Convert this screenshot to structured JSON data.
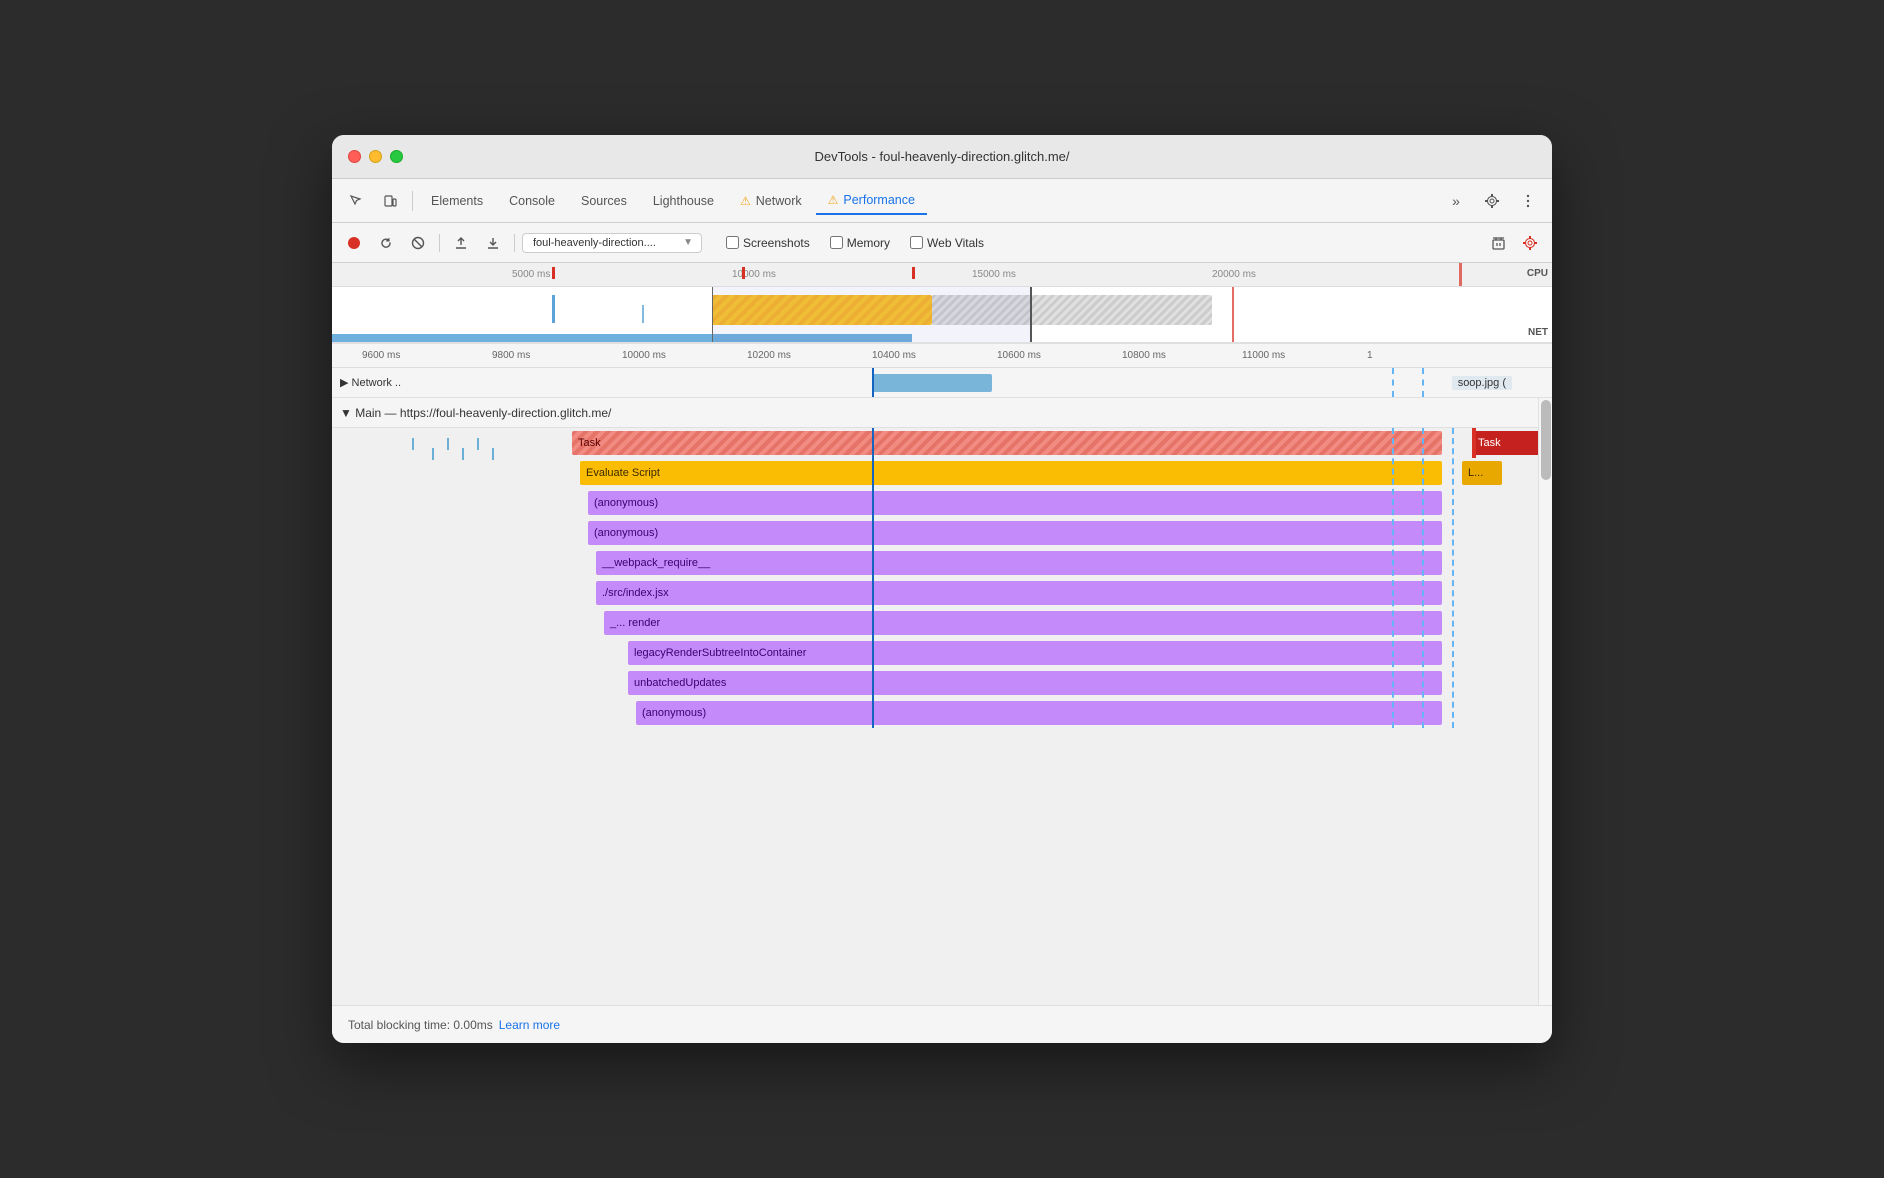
{
  "window": {
    "title": "DevTools - foul-heavenly-direction.glitch.me/"
  },
  "tabs": {
    "items": [
      {
        "label": "Elements",
        "active": false,
        "warn": false
      },
      {
        "label": "Console",
        "active": false,
        "warn": false
      },
      {
        "label": "Sources",
        "active": false,
        "warn": false
      },
      {
        "label": "Lighthouse",
        "active": false,
        "warn": false
      },
      {
        "label": "Network",
        "active": false,
        "warn": true
      },
      {
        "label": "Performance",
        "active": true,
        "warn": true
      }
    ],
    "more_label": "»"
  },
  "toolbar": {
    "url_value": "foul-heavenly-direction....",
    "screenshots_label": "Screenshots",
    "memory_label": "Memory",
    "web_vitals_label": "Web Vitals"
  },
  "timeline": {
    "ruler_ticks": [
      "5000 ms",
      "10000 ms",
      "15000 ms",
      "20000 ms"
    ],
    "zoom_ticks": [
      "9600 ms",
      "9800 ms",
      "10000 ms",
      "10200 ms",
      "10400 ms",
      "10600 ms",
      "10800 ms",
      "11000 ms",
      "1"
    ],
    "cpu_label": "CPU",
    "net_label": "NET"
  },
  "network_row": {
    "label": "▶ Network ..",
    "soop_label": "soop.jpg ("
  },
  "main_section": {
    "title": "▼ Main — https://foul-heavenly-direction.glitch.me/"
  },
  "flame_rows": [
    {
      "label": "Task",
      "type": "task",
      "indent": 0
    },
    {
      "label": "Evaluate Script",
      "type": "evaluate",
      "indent": 1
    },
    {
      "label": "(anonymous)",
      "type": "anon",
      "indent": 2
    },
    {
      "label": "(anonymous)",
      "type": "anon",
      "indent": 2
    },
    {
      "label": "__webpack_require__",
      "type": "anon",
      "indent": 3
    },
    {
      "label": "./src/index.jsx",
      "type": "anon",
      "indent": 3
    },
    {
      "label": "_...   render",
      "type": "anon",
      "indent": 4
    },
    {
      "label": "legacyRenderSubtreeIntoContainer",
      "type": "anon",
      "indent": 5
    },
    {
      "label": "unbatchedUpdates",
      "type": "anon",
      "indent": 5
    },
    {
      "label": "(anonymous)",
      "type": "anon",
      "indent": 6
    }
  ],
  "statusbar": {
    "blocking_time_text": "Total blocking time: 0.00ms",
    "learn_more_label": "Learn more"
  }
}
